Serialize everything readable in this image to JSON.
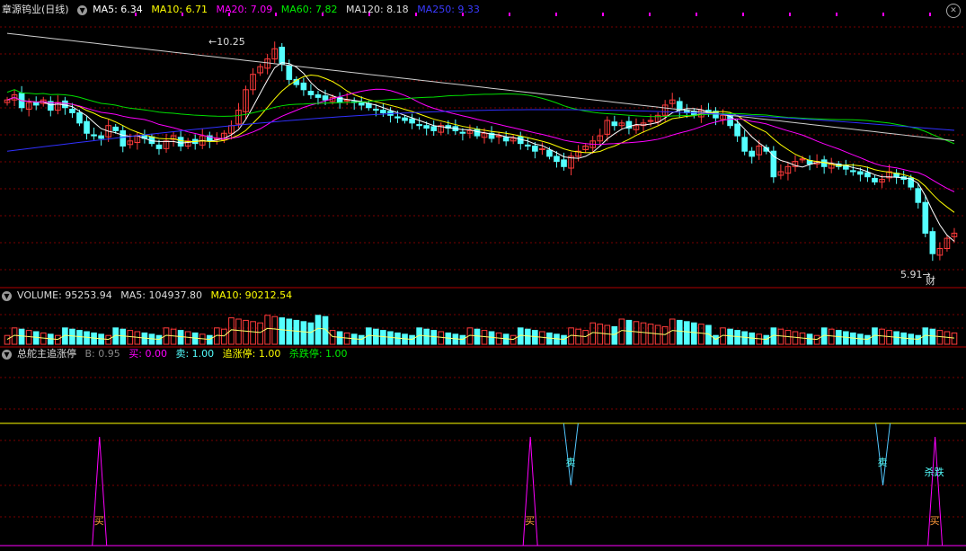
{
  "stock": {
    "name": "章源钨业",
    "period": "(日线)"
  },
  "price_panel": {
    "ma5": "MA5: 6.34",
    "ma10": "MA10: 6.71",
    "ma20": "MA20: 7.09",
    "ma60": "MA60: 7.82",
    "ma120": "MA120: 8.18",
    "ma250": "MA250: 9.33",
    "high_label": "10.25",
    "low_label": "5.91",
    "event_label": "财"
  },
  "volume_panel": {
    "vol": "VOLUME: 95253.94",
    "ma5": "MA5: 104937.80",
    "ma10": "MA10: 90212.54"
  },
  "indicator_panel": {
    "name": "总舵主追涨停",
    "b": "B: 0.95",
    "buy": "买: 0.00",
    "sell": "卖: 1.00",
    "chase": "追涨停: 1.00",
    "kill": "杀跌停: 1.00",
    "buy_text": "买",
    "sell_text": "卖",
    "kill_text": "杀跌"
  },
  "colors": {
    "up": "#ff3b3b",
    "down": "#54ffff",
    "ma5": "#ffffff",
    "ma10": "#ffff00",
    "ma20": "#ff00ff",
    "ma60": "#00e000",
    "ma120": "#d0d0d0",
    "ma250": "#3030ff",
    "grid": "#7a0000"
  },
  "chart_data": {
    "type": "candlestick",
    "ohlc_closes": [
      9.0,
      9.1,
      8.85,
      8.95,
      8.9,
      9.0,
      8.8,
      8.95,
      8.85,
      8.75,
      8.55,
      8.35,
      8.3,
      8.25,
      8.5,
      8.4,
      8.1,
      8.2,
      8.3,
      8.25,
      8.15,
      8.05,
      8.2,
      8.3,
      8.1,
      8.2,
      8.15,
      8.3,
      8.2,
      8.25,
      8.35,
      8.5,
      8.8,
      9.2,
      9.5,
      9.65,
      9.8,
      10.0,
      9.7,
      9.4,
      9.3,
      9.2,
      9.1,
      9.05,
      9.0,
      9.05,
      8.95,
      9.0,
      8.95,
      8.9,
      8.85,
      8.8,
      8.75,
      8.7,
      8.65,
      8.6,
      8.55,
      8.5,
      8.45,
      8.4,
      8.5,
      8.45,
      8.4,
      8.35,
      8.4,
      8.3,
      8.35,
      8.25,
      8.3,
      8.2,
      8.25,
      8.15,
      8.1,
      8.0,
      8.05,
      7.9,
      7.8,
      7.7,
      7.9,
      8.0,
      8.1,
      8.2,
      8.3,
      8.6,
      8.5,
      8.55,
      8.45,
      8.5,
      8.55,
      8.6,
      8.7,
      8.9,
      9.0,
      8.8,
      8.75,
      8.7,
      8.8,
      8.75,
      8.65,
      8.7,
      8.5,
      8.3,
      8.0,
      7.9,
      8.1,
      8.0,
      7.5,
      7.6,
      7.7,
      7.8,
      7.85,
      7.75,
      7.8,
      7.7,
      7.75,
      7.7,
      7.65,
      7.6,
      7.55,
      7.5,
      7.4,
      7.45,
      7.6,
      7.5,
      7.45,
      7.3,
      7.0,
      6.4,
      6.0,
      6.1,
      6.3,
      6.4
    ],
    "high_label": 10.25,
    "low_label": 5.91,
    "volume_ma5": 104937.8,
    "volume_ma10": 90212.54,
    "volume_last": 95253.94,
    "signals": {
      "buy_x": [
        0.103,
        0.549,
        0.968
      ],
      "sell_x": [
        0.591,
        0.914
      ],
      "kill_x": [
        0.968
      ]
    }
  }
}
